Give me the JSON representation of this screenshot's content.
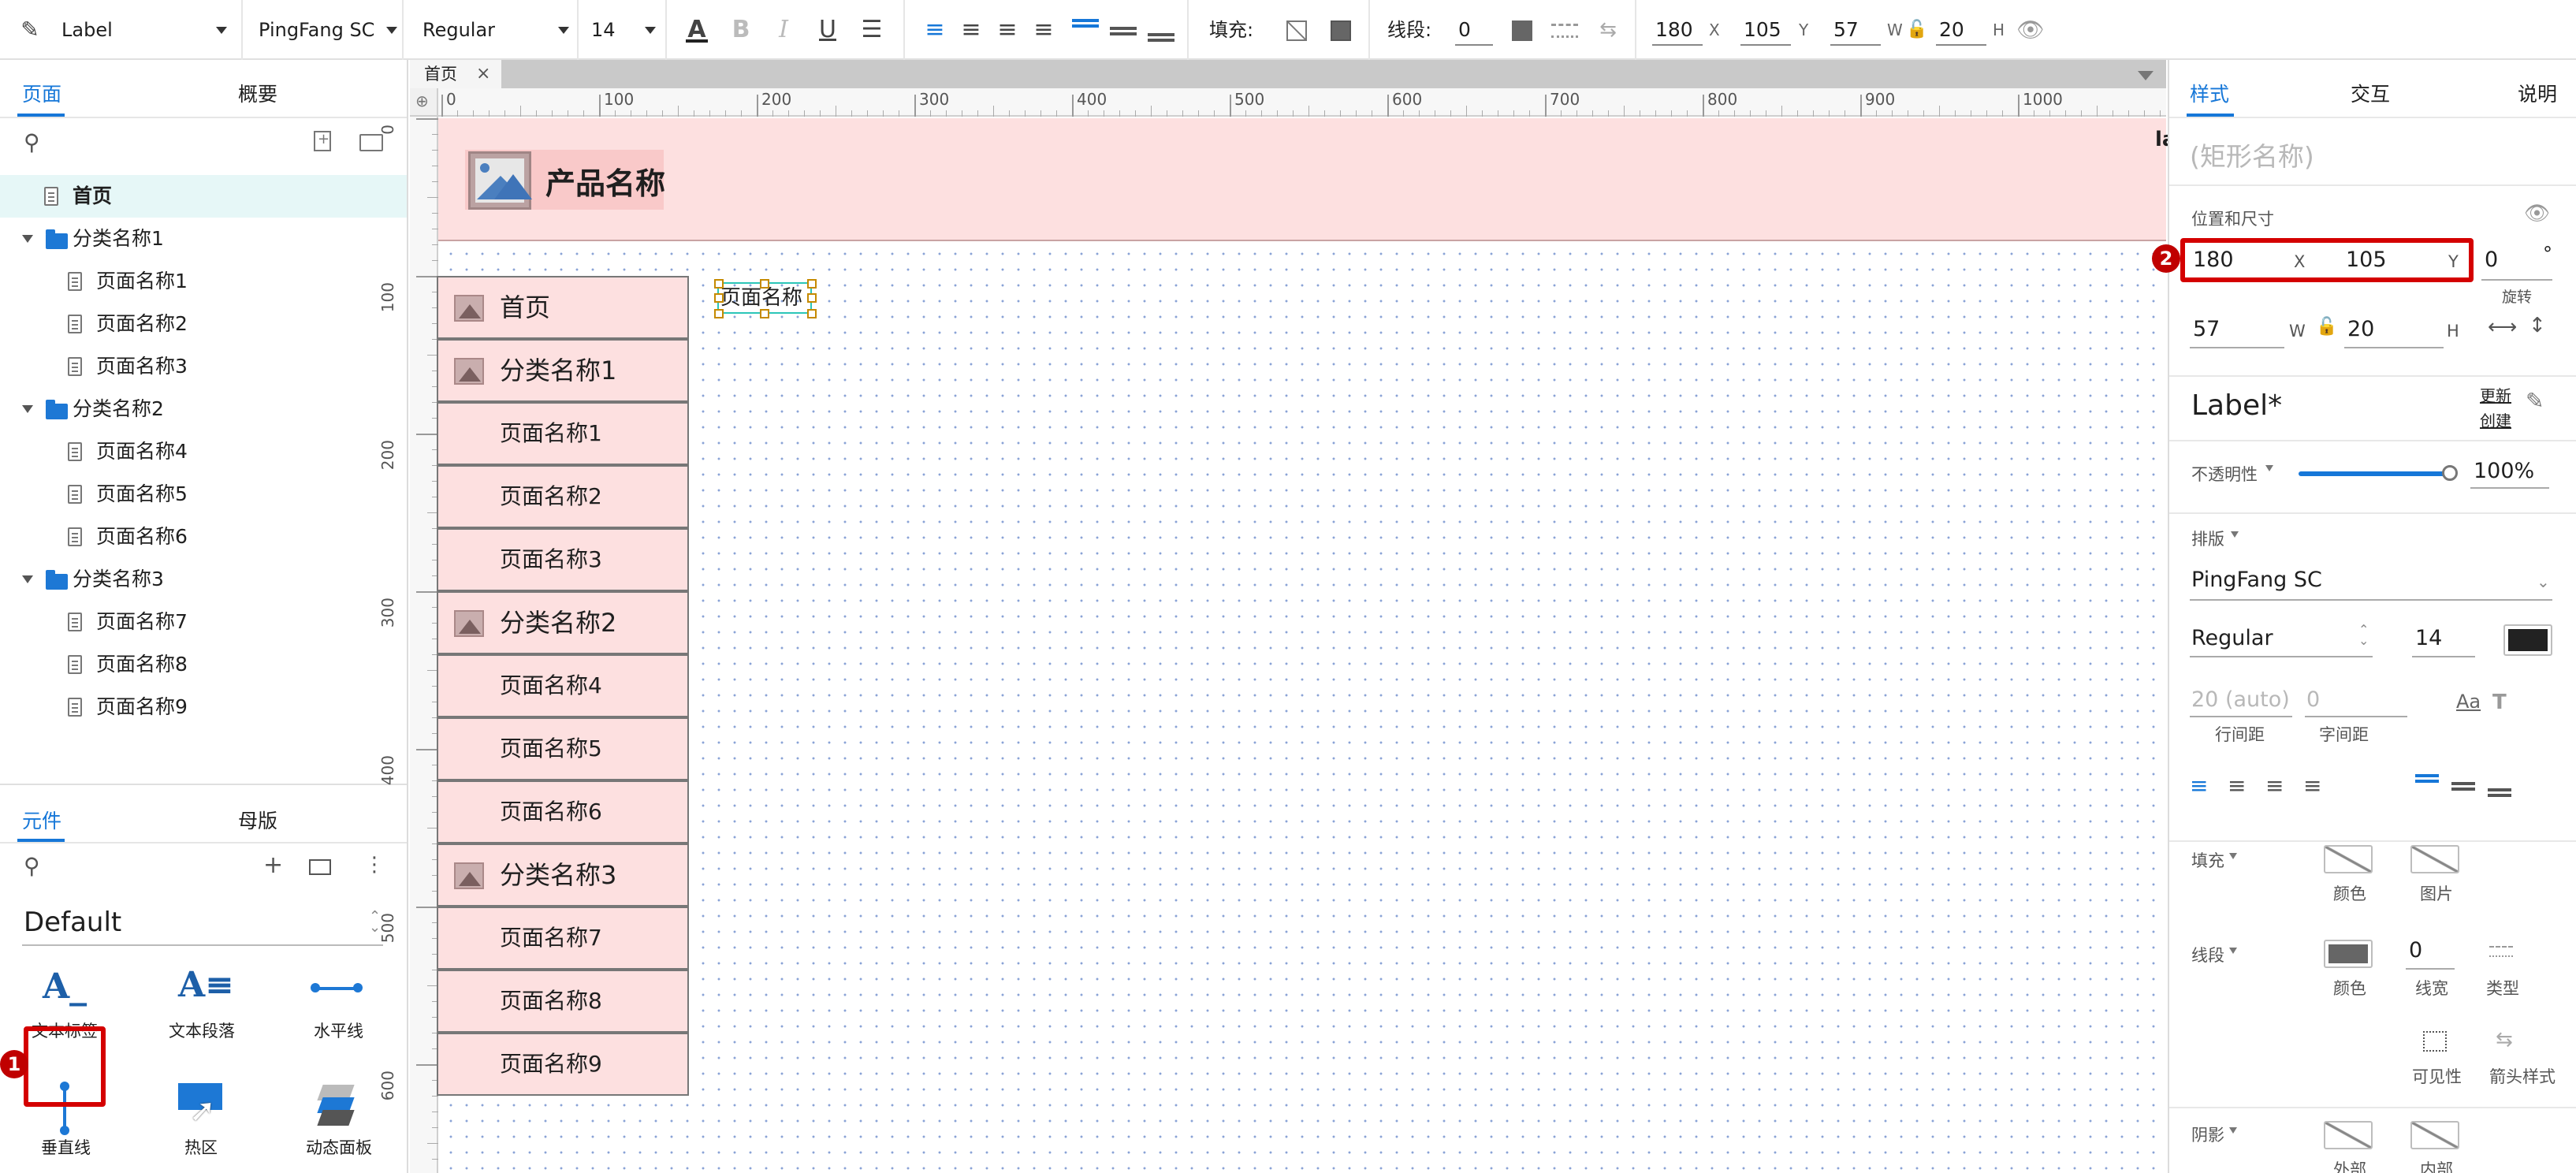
{
  "toolbar": {
    "element_type": "Label",
    "font_family": "PingFang SC",
    "font_weight": "Regular",
    "font_size": "14",
    "fill_label": "填充:",
    "stroke_label": "线段:",
    "stroke_width": "0",
    "x": "180",
    "x_unit": "X",
    "y": "105",
    "y_unit": "Y",
    "w": "57",
    "w_unit": "W",
    "h": "20",
    "h_unit": "H"
  },
  "left_panel": {
    "tabs": [
      "页面",
      "概要"
    ],
    "pages": [
      {
        "label": "首页",
        "kind": "page",
        "selected": true
      },
      {
        "label": "分类名称1",
        "kind": "folder"
      },
      {
        "label": "页面名称1",
        "kind": "page"
      },
      {
        "label": "页面名称2",
        "kind": "page"
      },
      {
        "label": "页面名称3",
        "kind": "page"
      },
      {
        "label": "分类名称2",
        "kind": "folder"
      },
      {
        "label": "页面名称4",
        "kind": "page"
      },
      {
        "label": "页面名称5",
        "kind": "page"
      },
      {
        "label": "页面名称6",
        "kind": "page"
      },
      {
        "label": "分类名称3",
        "kind": "folder"
      },
      {
        "label": "页面名称7",
        "kind": "page"
      },
      {
        "label": "页面名称8",
        "kind": "page"
      },
      {
        "label": "页面名称9",
        "kind": "page"
      }
    ],
    "lib_tabs": [
      "元件",
      "母版"
    ],
    "library_name": "Default",
    "components": [
      "文本标签",
      "文本段落",
      "水平线",
      "垂直线",
      "热区",
      "动态面板"
    ],
    "badge_1": "1"
  },
  "canvas": {
    "doc_tab": "首页",
    "ruler_h": [
      "0",
      "100",
      "200",
      "300",
      "400",
      "500",
      "600",
      "700",
      "800",
      "900",
      "1000"
    ],
    "ruler_v": [
      "0",
      "100",
      "200",
      "300",
      "400",
      "500",
      "600"
    ],
    "product_name": "产品名称",
    "header_cut": "la",
    "menu": [
      {
        "label": "首页",
        "icon": true
      },
      {
        "label": "分类名称1",
        "icon": true
      },
      {
        "label": "页面名称1",
        "icon": false
      },
      {
        "label": "页面名称2",
        "icon": false
      },
      {
        "label": "页面名称3",
        "icon": false
      },
      {
        "label": "分类名称2",
        "icon": true
      },
      {
        "label": "页面名称4",
        "icon": false
      },
      {
        "label": "页面名称5",
        "icon": false
      },
      {
        "label": "页面名称6",
        "icon": false
      },
      {
        "label": "分类名称3",
        "icon": true
      },
      {
        "label": "页面名称7",
        "icon": false
      },
      {
        "label": "页面名称8",
        "icon": false
      },
      {
        "label": "页面名称9",
        "icon": false
      }
    ],
    "selected_label_text": "页面名称"
  },
  "right_panel": {
    "tabs": [
      "样式",
      "交互",
      "说明"
    ],
    "shape_name_placeholder": "(矩形名称)",
    "pos_size_label": "位置和尺寸",
    "x": "180",
    "x_unit": "X",
    "y": "105",
    "y_unit": "Y",
    "rotation": "0",
    "rotation_unit": "°",
    "rotation_label": "旋转",
    "w": "57",
    "w_unit": "W",
    "h": "20",
    "h_unit": "H",
    "badge_2": "2",
    "style_name": "Label*",
    "update_label": "更新",
    "create_label": "创建",
    "opacity_label": "不透明性",
    "opacity_value": "100%",
    "typography_label": "排版",
    "font_family": "PingFang SC",
    "font_weight": "Regular",
    "font_size": "14",
    "line_height": "20 (auto)",
    "letter_spacing": "0",
    "line_height_label": "行间距",
    "letter_spacing_label": "字间距",
    "fill_label": "填充",
    "fill_color_label": "颜色",
    "fill_image_label": "图片",
    "stroke_label": "线段",
    "stroke_color_label": "颜色",
    "stroke_width": "0",
    "stroke_width_label": "线宽",
    "stroke_type_label": "类型",
    "visibility_label": "可见性",
    "arrow_label": "箭头样式",
    "shadow_label": "阴影",
    "shadow_outer": "外部",
    "shadow_inner": "内部"
  },
  "colors": {
    "accent": "#1677d8",
    "pink": "#fde0e0",
    "highlight": "#d40000"
  }
}
